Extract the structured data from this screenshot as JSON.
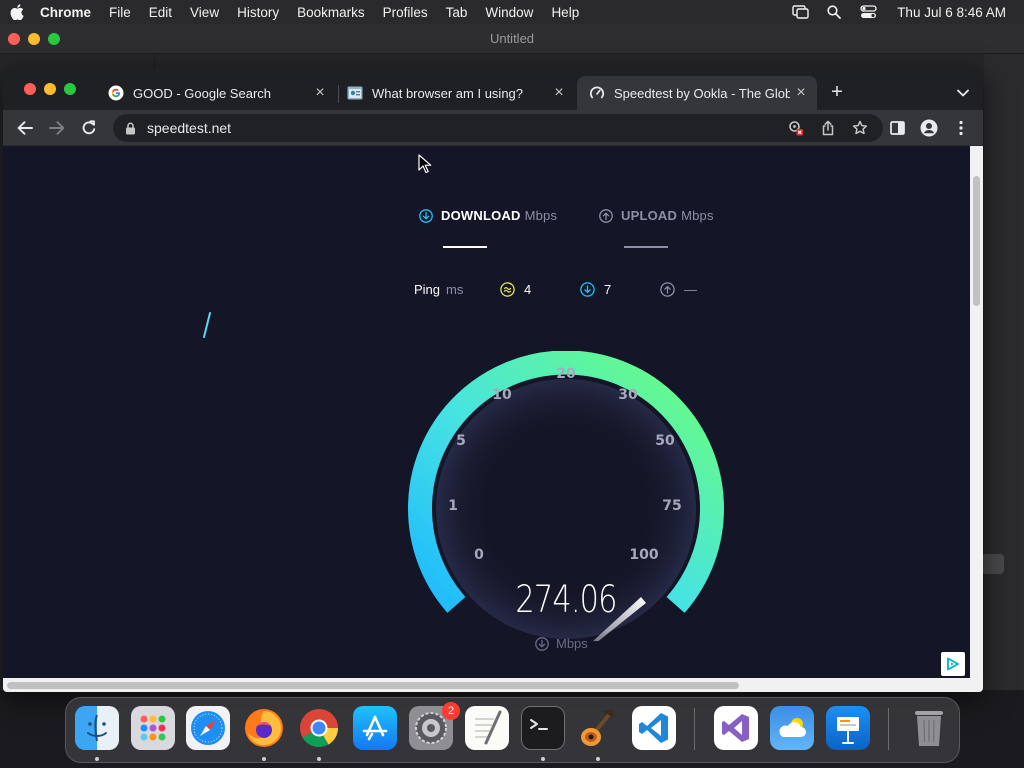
{
  "menubar": {
    "app": "Chrome",
    "items": [
      "File",
      "Edit",
      "View",
      "History",
      "Bookmarks",
      "Profiles",
      "Tab",
      "Window",
      "Help"
    ],
    "clock": "Thu Jul 6  8:46 AM"
  },
  "background_window": {
    "title": "Untitled"
  },
  "tabs": [
    {
      "label": "GOOD - Google Search",
      "icon": "google-icon",
      "active": false
    },
    {
      "label": "What browser am I using?",
      "icon": "site-icon",
      "active": false
    },
    {
      "label": "Speedtest by Ookla - The Glob",
      "icon": "speedtest-icon",
      "active": true
    }
  ],
  "address_bar": {
    "url": "speedtest.net"
  },
  "speedtest": {
    "download_label": "DOWNLOAD",
    "download_unit": "Mbps",
    "upload_label": "UPLOAD",
    "upload_unit": "Mbps",
    "ping_label": "Ping",
    "ping_unit": "ms",
    "ping_idle": "4",
    "ping_download": "7",
    "ping_upload": "—",
    "gauge_ticks": [
      "0",
      "1",
      "5",
      "10",
      "20",
      "30",
      "50",
      "75",
      "100"
    ],
    "speed_value": "274.06",
    "speed_unit": "Mbps",
    "colors": {
      "accent_cyan": "#1cc4ff",
      "accent_green": "#6cff78",
      "bg": "#141526"
    }
  },
  "dock": {
    "apps": [
      "Finder",
      "Launchpad",
      "Safari",
      "Firefox",
      "Chrome",
      "App Store",
      "System Settings",
      "TextEdit",
      "Terminal",
      "GarageBand",
      "Visual Studio Code",
      "Visual Studio",
      "Weather",
      "Keynote",
      "Trash"
    ],
    "settings_badge": "2"
  }
}
